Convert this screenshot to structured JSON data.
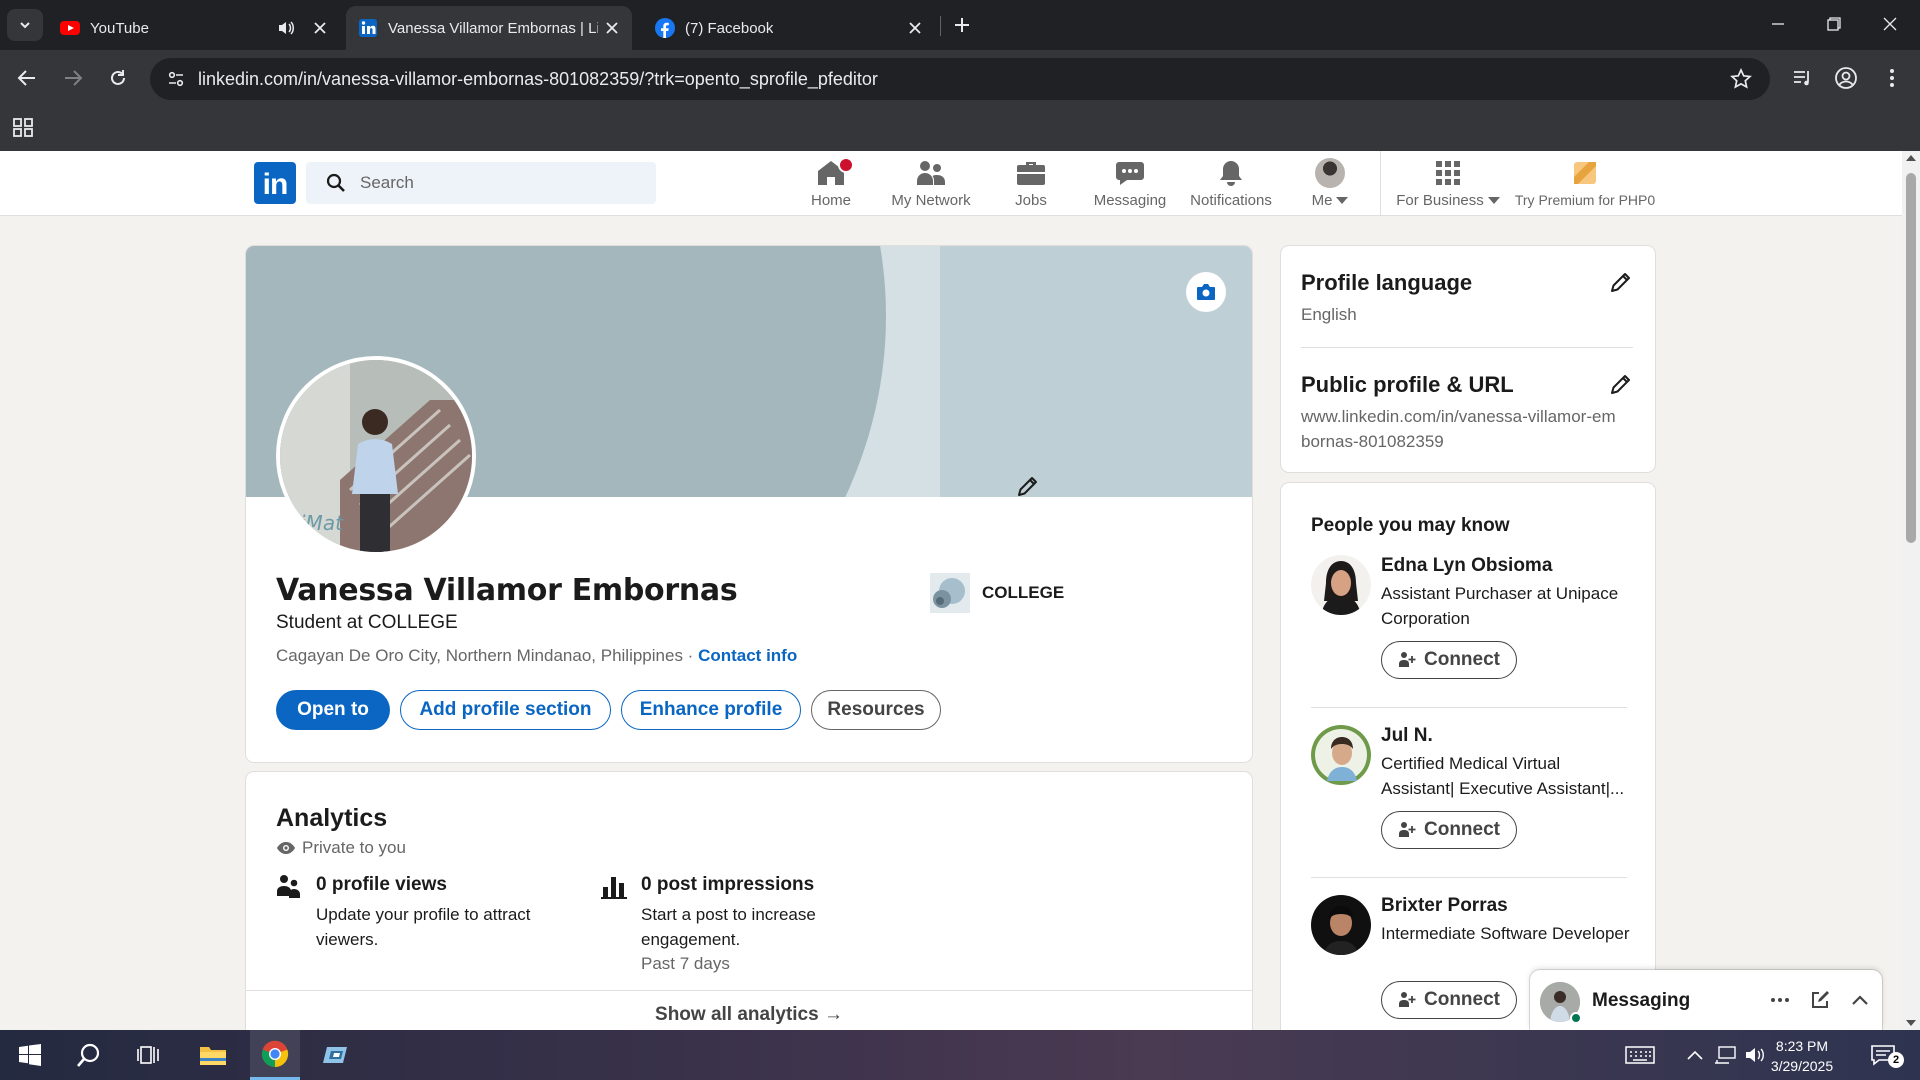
{
  "browser": {
    "tabs": [
      {
        "title": "YouTube",
        "icon": "youtube-icon"
      },
      {
        "title": "Vanessa Villamor Embornas | Li",
        "icon": "linkedin-icon",
        "active": true
      },
      {
        "title": "(7) Facebook",
        "icon": "facebook-icon"
      }
    ],
    "url": "linkedin.com/in/vanessa-villamor-embornas-801082359/?trk=opento_sprofile_pfeditor"
  },
  "linkedin_nav": {
    "logo": "in",
    "search_placeholder": "Search",
    "items": [
      {
        "label": "Home",
        "icon": "home-icon"
      },
      {
        "label": "My Network",
        "icon": "my-network-icon"
      },
      {
        "label": "Jobs",
        "icon": "jobs-icon"
      },
      {
        "label": "Messaging",
        "icon": "messaging-icon"
      },
      {
        "label": "Notifications",
        "icon": "notifications-icon"
      },
      {
        "label": "Me",
        "icon": "avatar"
      },
      {
        "label": "For Business",
        "icon": "grid-icon"
      },
      {
        "label": "Try Premium for PHP0",
        "icon": "premium-icon"
      }
    ]
  },
  "profile": {
    "name": "Vanessa Villamor Embornas",
    "headline": "Student at COLLEGE",
    "location": "Cagayan De Oro City, Northern Mindanao, Philippines",
    "separator": " · ",
    "contact_info": "Contact info",
    "education": "COLLEGE",
    "buttons": {
      "open_to": "Open to",
      "add_section": "Add profile section",
      "enhance": "Enhance profile",
      "resources": "Resources"
    }
  },
  "analytics": {
    "title": "Analytics",
    "private": "Private to you",
    "items": [
      {
        "title": "0 profile views",
        "desc": "Update your profile to attract viewers."
      },
      {
        "title": "0 post impressions",
        "desc": "Start a post to increase engagement.",
        "sub": "Past 7 days"
      }
    ],
    "show_all": "Show all analytics →"
  },
  "side": {
    "profile_language": {
      "title": "Profile language",
      "value": "English"
    },
    "public_profile": {
      "title": "Public profile & URL",
      "value": "www.linkedin.com/in/vanessa-villamor-embornas-801082359"
    }
  },
  "pymk": {
    "title": "People you may know",
    "connect_label": "Connect",
    "people": [
      {
        "name": "Edna Lyn Obsioma",
        "headline": "Assistant Purchaser at Unipace Corporation"
      },
      {
        "name": "Jul N.",
        "headline": "Certified Medical Virtual Assistant| Executive Assistant|..."
      },
      {
        "name": "Brixter Porras",
        "headline": "Intermediate Software Developer"
      }
    ]
  },
  "messaging": {
    "label": "Messaging"
  },
  "taskbar": {
    "time": "8:23 PM",
    "date": "3/29/2025",
    "notification_count": "2"
  },
  "colors": {
    "linkedin_blue": "#0a66c2",
    "page_bg": "#f4f2ee",
    "chrome_dark": "#202124",
    "chrome_toolbar": "#35363a"
  }
}
